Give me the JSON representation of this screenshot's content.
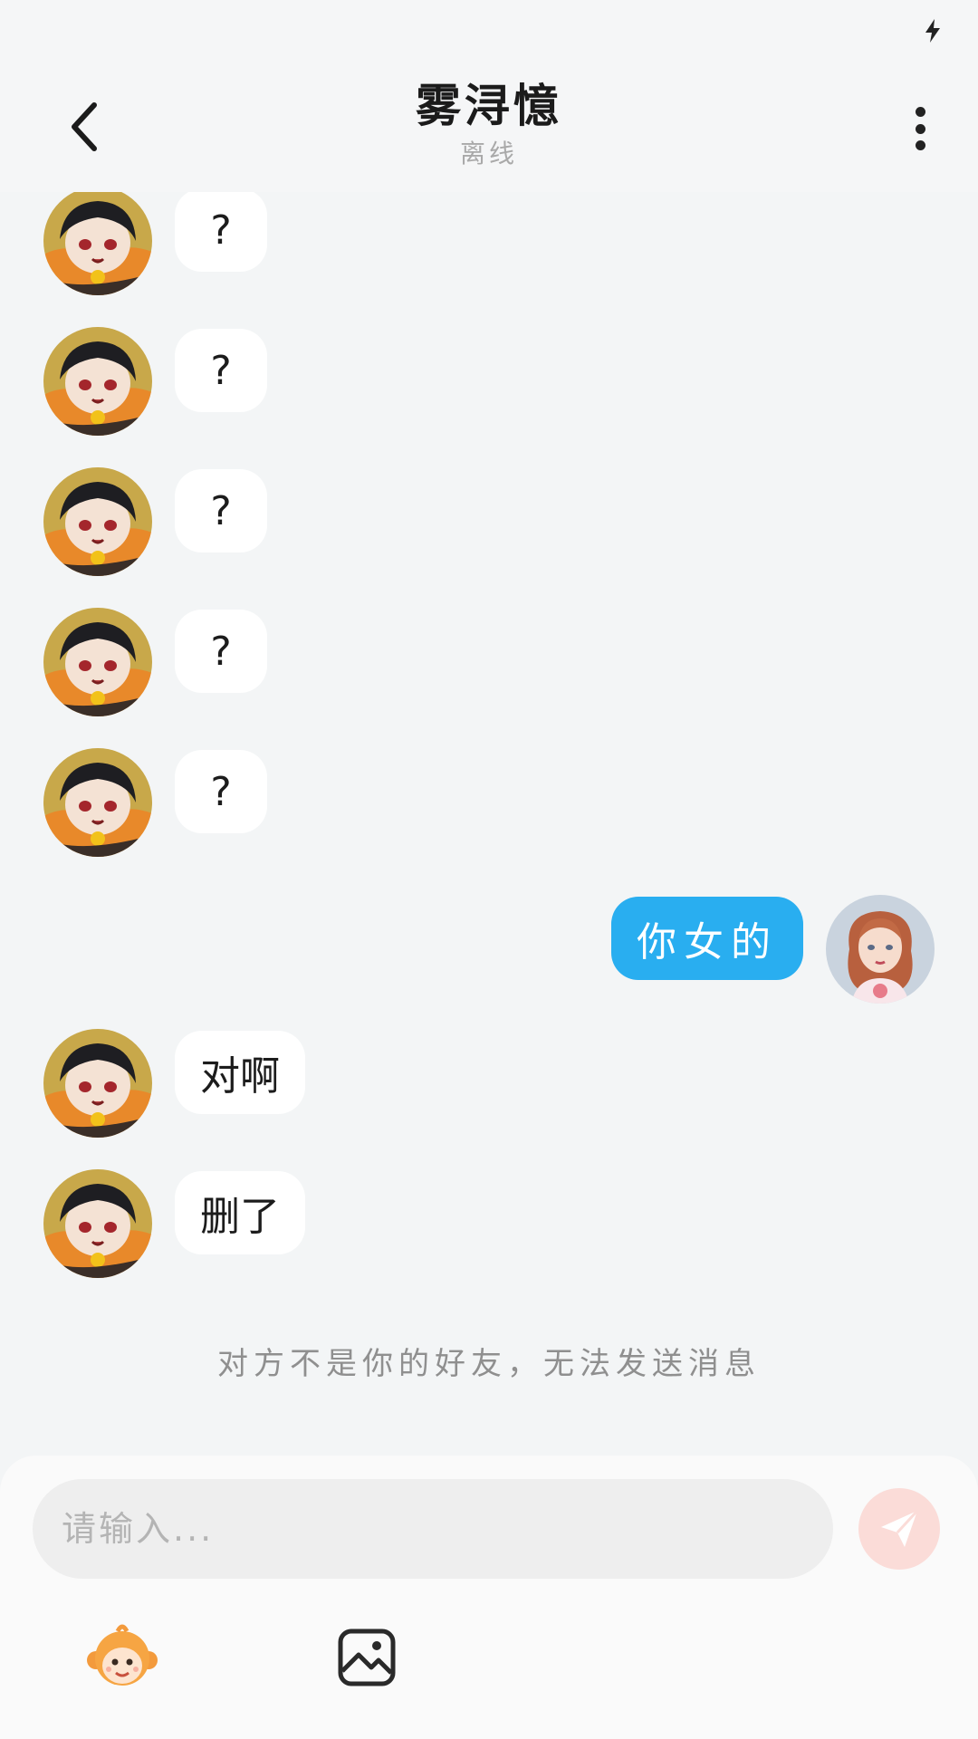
{
  "header": {
    "title": "雾浔憶",
    "status": "离线",
    "back_icon": "chevron-left-icon",
    "more_icon": "more-vertical-icon"
  },
  "messages": [
    {
      "side": "left",
      "text": "?"
    },
    {
      "side": "left",
      "text": "?"
    },
    {
      "side": "left",
      "text": "?"
    },
    {
      "side": "left",
      "text": "?"
    },
    {
      "side": "left",
      "text": "?"
    },
    {
      "side": "right",
      "text": "你女的"
    },
    {
      "side": "left",
      "text": "对啊"
    },
    {
      "side": "left",
      "text": "删了"
    }
  ],
  "system_note": "对方不是你的好友，无法发送消息",
  "composer": {
    "placeholder": "请输入...",
    "send_icon": "paper-plane-icon",
    "sticker_icon": "monkey-sticker-icon",
    "image_icon": "image-icon"
  },
  "colors": {
    "accent_blue": "#29aef0",
    "send_disabled": "#fbdcd8",
    "background": "#f3f5f6"
  }
}
